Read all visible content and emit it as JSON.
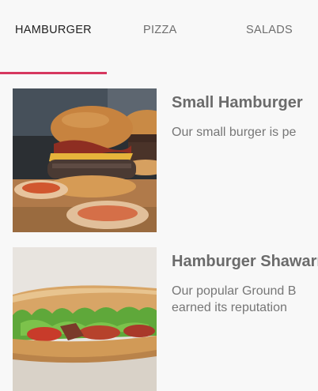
{
  "tabs": [
    {
      "label": "HAMBURGER",
      "active": true
    },
    {
      "label": "PIZZA",
      "active": false
    },
    {
      "label": "SALADS",
      "active": false
    }
  ],
  "accent_color": "#d6375f",
  "items": [
    {
      "title": "Small Hamburger",
      "description_lines": [
        "Our small burger is pe"
      ],
      "image": "burger-photo"
    },
    {
      "title": "Hamburger Shawarma",
      "description_lines": [
        "Our popular Ground B",
        "earned its reputation"
      ],
      "image": "shawarma-sandwich-photo"
    }
  ]
}
